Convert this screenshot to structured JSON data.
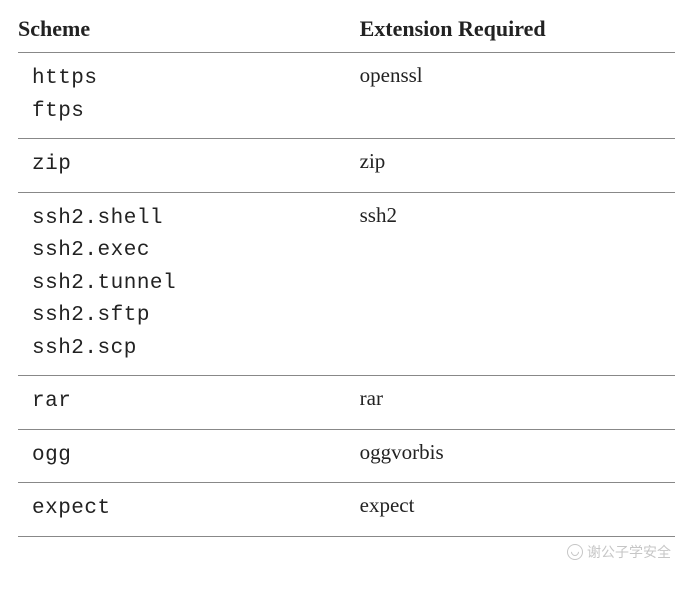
{
  "table": {
    "headers": [
      "Scheme",
      "Extension Required"
    ],
    "rows": [
      {
        "schemes": [
          "https",
          "ftps"
        ],
        "extension": "openssl"
      },
      {
        "schemes": [
          "zip"
        ],
        "extension": "zip"
      },
      {
        "schemes": [
          "ssh2.shell",
          "ssh2.exec",
          "ssh2.tunnel",
          "ssh2.sftp",
          "ssh2.scp"
        ],
        "extension": "ssh2"
      },
      {
        "schemes": [
          "rar"
        ],
        "extension": "rar"
      },
      {
        "schemes": [
          "ogg"
        ],
        "extension": "oggvorbis"
      },
      {
        "schemes": [
          "expect"
        ],
        "extension": "expect"
      }
    ]
  },
  "watermark": {
    "text": "谢公子学安全"
  }
}
